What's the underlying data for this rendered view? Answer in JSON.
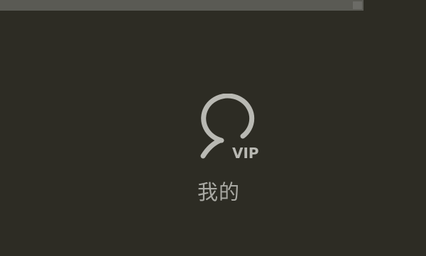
{
  "menu_tile": {
    "icon": "user-vip-icon",
    "badge": "VIP",
    "label": "我的"
  },
  "colors": {
    "background": "#2d2c24",
    "top_bar": "#5a5a54",
    "icon": "#b9b9b3",
    "label": "#a9a9a3"
  }
}
